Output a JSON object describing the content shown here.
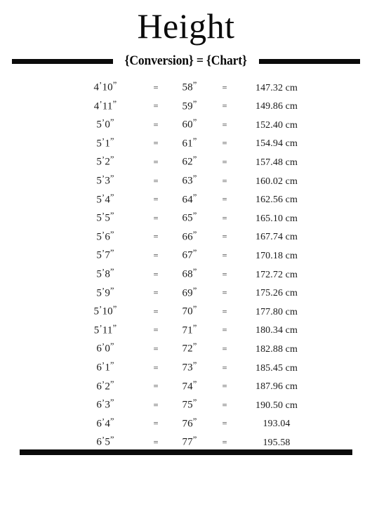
{
  "document": {
    "title": "Height",
    "subtitle": "{Conversion} = {Chart}",
    "accent_color": "#0b0b0b",
    "background_color": "#ffffff",
    "text_color": "#1a1a1a"
  },
  "table": {
    "equals_symbol": "=",
    "rows": [
      {
        "feet": "4'10\"",
        "eq1": "=",
        "inches": "58\"",
        "eq2": "=",
        "cm": "147.32 cm"
      },
      {
        "feet": "4'11\"",
        "eq1": "=",
        "inches": "59\"",
        "eq2": "=",
        "cm": "149.86 cm"
      },
      {
        "feet": "5'0\"",
        "eq1": "=",
        "inches": "60\"",
        "eq2": "=",
        "cm": "152.40 cm"
      },
      {
        "feet": "5'1\"",
        "eq1": "=",
        "inches": "61\"",
        "eq2": "=",
        "cm": "154.94 cm"
      },
      {
        "feet": "5'2\"",
        "eq1": "=",
        "inches": "62\"",
        "eq2": "=",
        "cm": "157.48 cm"
      },
      {
        "feet": "5'3\"",
        "eq1": "=",
        "inches": "63\"",
        "eq2": "=",
        "cm": "160.02 cm"
      },
      {
        "feet": "5'4\"",
        "eq1": "=",
        "inches": "64\"",
        "eq2": "=",
        "cm": "162.56 cm"
      },
      {
        "feet": "5'5\"",
        "eq1": "=",
        "inches": "65\"",
        "eq2": "=",
        "cm": "165.10 cm"
      },
      {
        "feet": "5'6\"",
        "eq1": "=",
        "inches": "66\"",
        "eq2": "=",
        "cm": "167.74 cm"
      },
      {
        "feet": "5'7\"",
        "eq1": "=",
        "inches": "67\"",
        "eq2": "=",
        "cm": "170.18 cm"
      },
      {
        "feet": "5'8\"",
        "eq1": "=",
        "inches": "68\"",
        "eq2": "=",
        "cm": "172.72 cm"
      },
      {
        "feet": "5'9\"",
        "eq1": "=",
        "inches": "69\"",
        "eq2": "=",
        "cm": "175.26 cm"
      },
      {
        "feet": "5'10\"",
        "eq1": "=",
        "inches": "70\"",
        "eq2": "=",
        "cm": "177.80 cm"
      },
      {
        "feet": "5'11\"",
        "eq1": "=",
        "inches": "71\"",
        "eq2": "=",
        "cm": "180.34 cm"
      },
      {
        "feet": "6'0\"",
        "eq1": "=",
        "inches": "72\"",
        "eq2": "=",
        "cm": "182.88 cm"
      },
      {
        "feet": "6'1\"",
        "eq1": "=",
        "inches": "73\"",
        "eq2": "=",
        "cm": "185.45 cm"
      },
      {
        "feet": "6'2\"",
        "eq1": "=",
        "inches": "74\"",
        "eq2": "=",
        "cm": "187.96 cm"
      },
      {
        "feet": "6'3\"",
        "eq1": "=",
        "inches": "75\"",
        "eq2": "=",
        "cm": "190.50 cm"
      },
      {
        "feet": "6'4\"",
        "eq1": "=",
        "inches": "76\"",
        "eq2": "=",
        "cm": "193.04"
      },
      {
        "feet": "6'5\"",
        "eq1": "=",
        "inches": "77\"",
        "eq2": "=",
        "cm": "195.58"
      }
    ]
  }
}
